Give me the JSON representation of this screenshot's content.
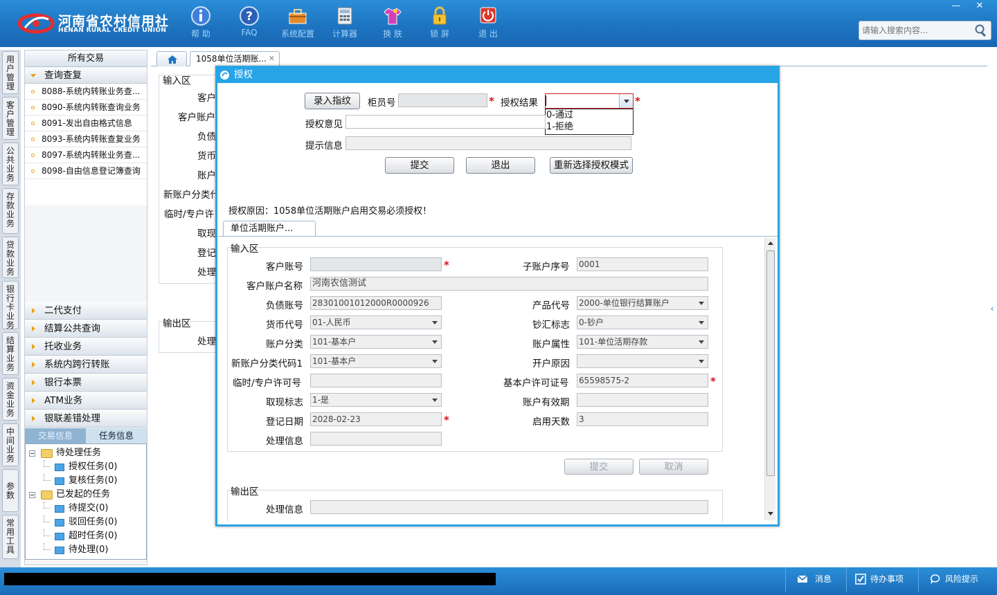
{
  "header": {
    "logo_cn": "河南省农村信用社",
    "logo_en": "HENAN RURAL CREDIT UNION",
    "toolbar": [
      {
        "label": "帮 助",
        "icon": "info-icon"
      },
      {
        "label": "FAQ",
        "icon": "question-icon"
      },
      {
        "label": "系统配置",
        "icon": "toolbox-icon"
      },
      {
        "label": "计算器",
        "icon": "calculator-icon"
      },
      {
        "label": "换 肤",
        "icon": "shirt-icon"
      },
      {
        "label": "锁 屏",
        "icon": "lock-icon"
      },
      {
        "label": "退 出",
        "icon": "power-icon"
      }
    ],
    "search_placeholder": "请输入搜索内容...",
    "min_label": "—",
    "close_label": "✕"
  },
  "vtabs": [
    "用户管理",
    "客户管理",
    "公共业务",
    "存款业务",
    "贷款业务",
    "银行卡业务",
    "结算业务",
    "资金业务",
    "中间业务",
    "参数",
    "常用工具"
  ],
  "sidebar": {
    "title": "所有交易",
    "open_group": "查询查复",
    "items": [
      "8088-系统内转账业务查...",
      "8090-系统内转账查询业务",
      "8091-发出自由格式信息",
      "8093-系统内转账查复业务",
      "8097-系统内转账业务查...",
      "8098-自由信息登记簿查询"
    ],
    "groups": [
      "二代支付",
      "结算公共查询",
      "托收业务",
      "系统内跨行转账",
      "银行本票",
      "ATM业务",
      "银联差错处理"
    ],
    "lower_tabs": {
      "left": "交易信息",
      "right": "任务信息"
    },
    "tree": {
      "pending": "待处理任务",
      "pending_items": [
        "授权任务(0)",
        "复核任务(0)"
      ],
      "initiated": "已发起的任务",
      "initiated_items": [
        "待提交(0)",
        "驳回任务(0)",
        "超时任务(0)",
        "待处理(0)"
      ]
    }
  },
  "main": {
    "doc_tab": "1058单位活期账...",
    "bg_labels": {
      "input_area": "输入区",
      "l1": "客户",
      "l2": "客户账户",
      "l3": "负债",
      "l4": "货币",
      "l5": "账户",
      "l6": "新账户分类代",
      "l7": "临时/专户许",
      "l8": "取现",
      "l9": "登记",
      "l10": "处理",
      "output_area": "输出区",
      "l11": "处理"
    }
  },
  "dialog": {
    "title": "授权",
    "fingerprint_btn": "录入指纹",
    "teller_label": "柜员号",
    "auth_result_label": "授权结果",
    "auth_options": [
      "0-通过",
      "1-拒绝"
    ],
    "auth_opinion_label": "授权意见",
    "hint_label": "提示信息",
    "submit_btn": "提交",
    "exit_btn": "退出",
    "reselect_btn": "重新选择授权模式",
    "reason": "授权原因：1058单位活期账户启用交易必须授权！",
    "inner_tab": "单位活期账户...",
    "form": {
      "input_area": "输入区",
      "cust_account_label": "客户账号",
      "sub_seq_label": "子账户序号",
      "sub_seq_value": "0001",
      "cust_name_label": "客户账户名称",
      "cust_name_value": "河南农信测试",
      "liability_label": "负债账号",
      "liability_value": "28301001012000R0000926",
      "product_label": "产品代号",
      "product_value": "2000-单位银行结算账户",
      "currency_label": "货币代号",
      "currency_value": "01-人民币",
      "cash_flag_label": "钞汇标志",
      "cash_flag_value": "0-钞户",
      "acct_class_label": "账户分类",
      "acct_class_value": "101-基本户",
      "acct_attr_label": "账户属性",
      "acct_attr_value": "101-单位活期存款",
      "new_class_label": "新账户分类代码1",
      "new_class_value": "101-基本户",
      "open_reason_label": "开户原因",
      "temp_license_label": "临时/专户许可号",
      "basic_license_label": "基本户许可证号",
      "basic_license_value": "65598575-2",
      "withdraw_label": "取现标志",
      "withdraw_value": "1-是",
      "validity_label": "账户有效期",
      "reg_date_label": "登记日期",
      "reg_date_value": "2028-02-23",
      "enable_days_label": "启用天数",
      "enable_days_value": "3",
      "process_info_label": "处理信息",
      "submit_btn": "提交",
      "cancel_btn": "取消",
      "output_area": "输出区",
      "out_process_label": "处理信息"
    }
  },
  "statusbar": {
    "msg": "消息",
    "todo": "待办事项",
    "risk": "风险提示"
  }
}
